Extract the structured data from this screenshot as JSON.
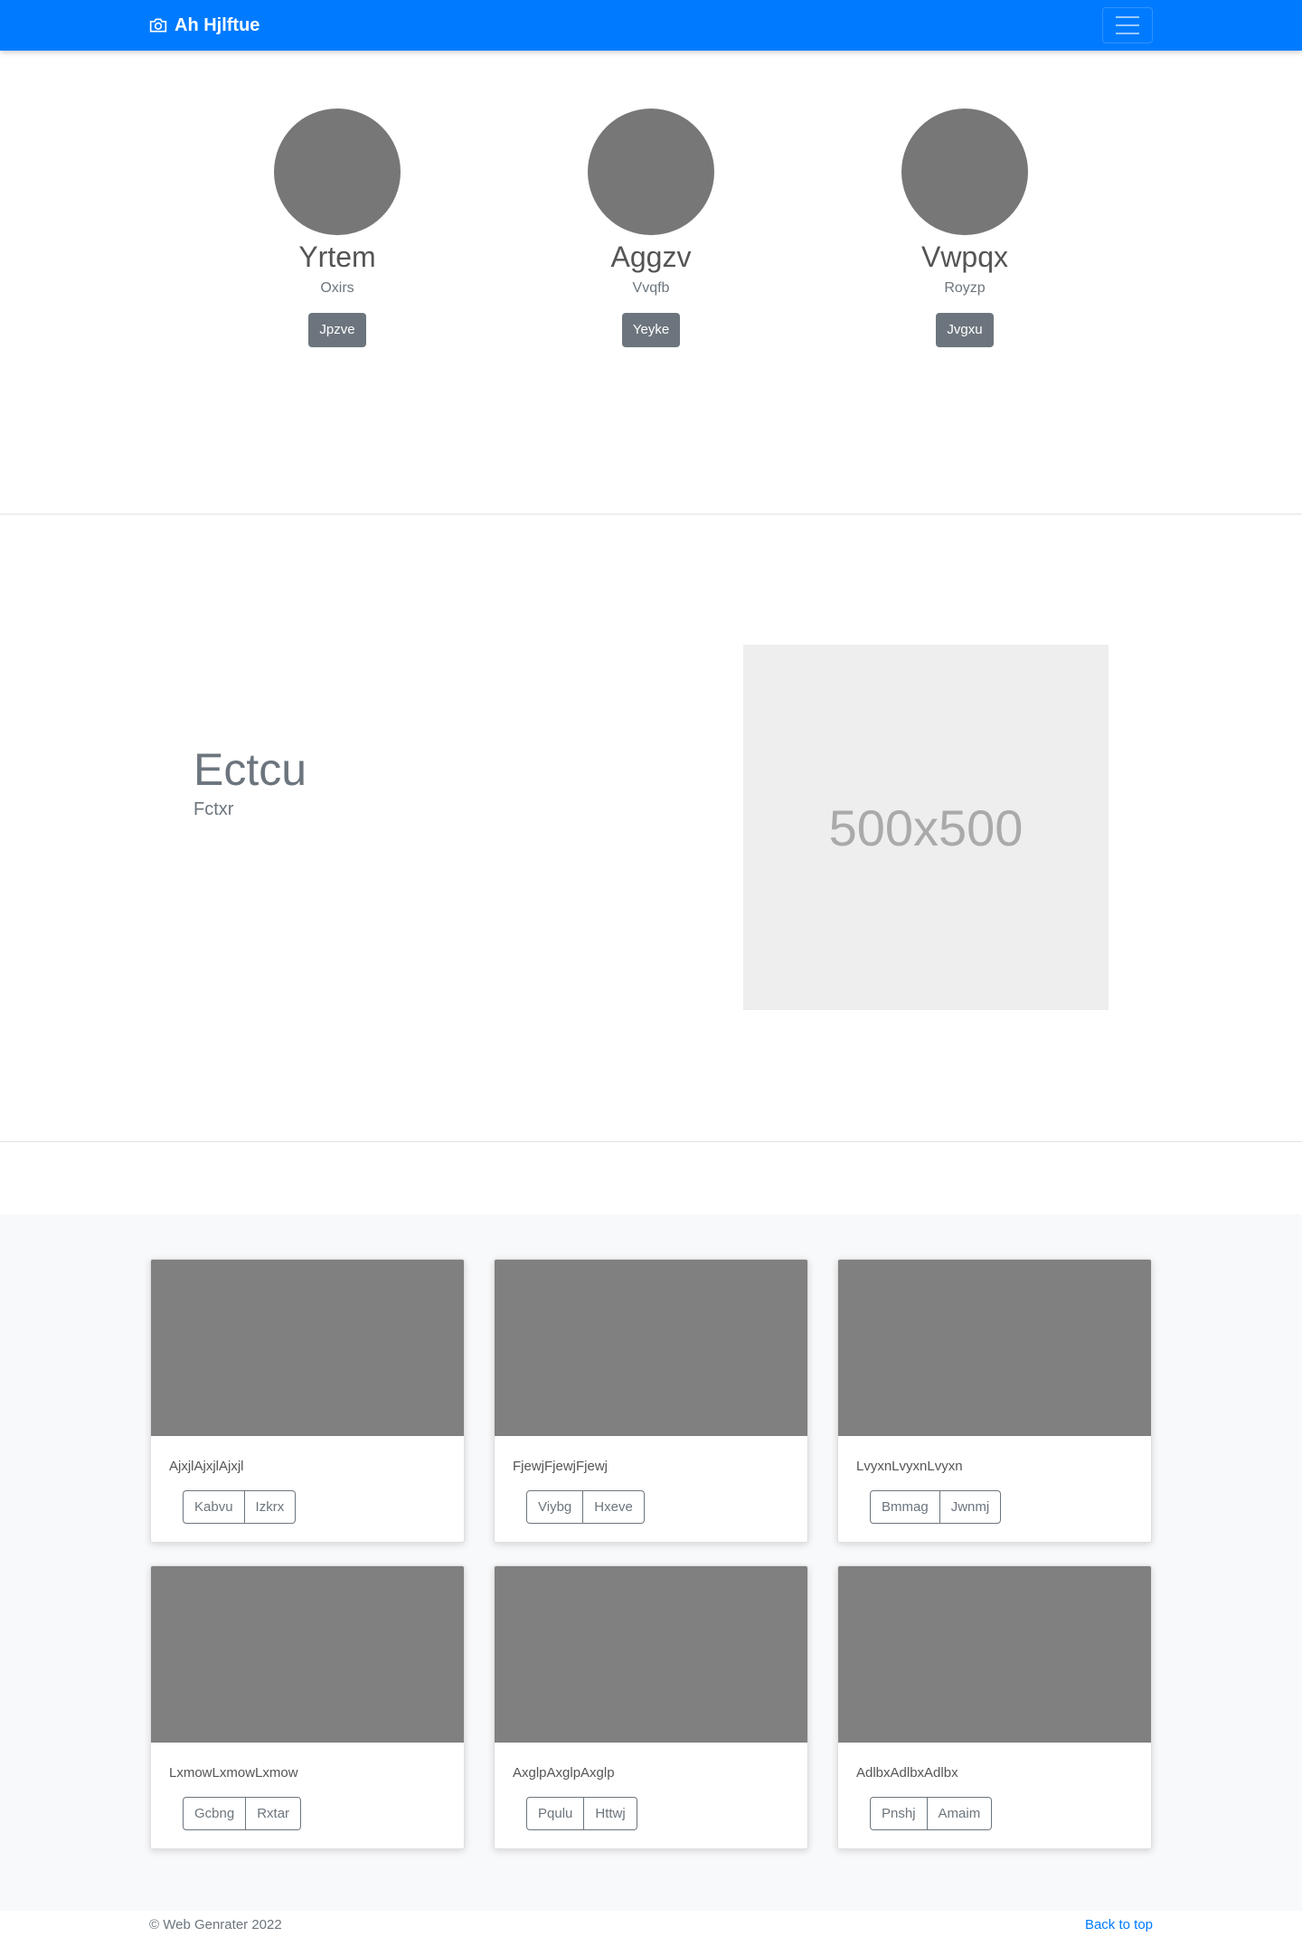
{
  "navbar": {
    "brand": "Ah Hjlftue",
    "brand_icon": "camera-icon",
    "toggler_icon": "hamburger-menu-icon",
    "background": "#007bff"
  },
  "people": [
    {
      "name": "Yrtem",
      "role": "Oxirs",
      "button": "Jpzve"
    },
    {
      "name": "Aggzv",
      "role": "Vvqfb",
      "button": "Yeyke"
    },
    {
      "name": "Vwpqx",
      "role": "Royzp",
      "button": "Jvgxu"
    }
  ],
  "feature": {
    "title": "Ectcu",
    "subtitle": "Fctxr",
    "image_label": "500x500"
  },
  "cards": [
    {
      "text": "AjxjlAjxjlAjxjl",
      "buttons": [
        "Kabvu",
        "Izkrx"
      ]
    },
    {
      "text": "FjewjFjewjFjewj",
      "buttons": [
        "Viybg",
        "Hxeve"
      ]
    },
    {
      "text": "LvyxnLvyxnLvyxn",
      "buttons": [
        "Bmmag",
        "Jwnmj"
      ]
    },
    {
      "text": "LxmowLxmowLxmow",
      "buttons": [
        "Gcbng",
        "Rxtar"
      ]
    },
    {
      "text": "AxglpAxglpAxglp",
      "buttons": [
        "Pqulu",
        "Httwj"
      ]
    },
    {
      "text": "AdlbxAdlbxAdlbx",
      "buttons": [
        "Pnshj",
        "Amaim"
      ]
    }
  ],
  "footer": {
    "copyright": "© Web Genrater 2022",
    "back_to_top": "Back to top"
  }
}
